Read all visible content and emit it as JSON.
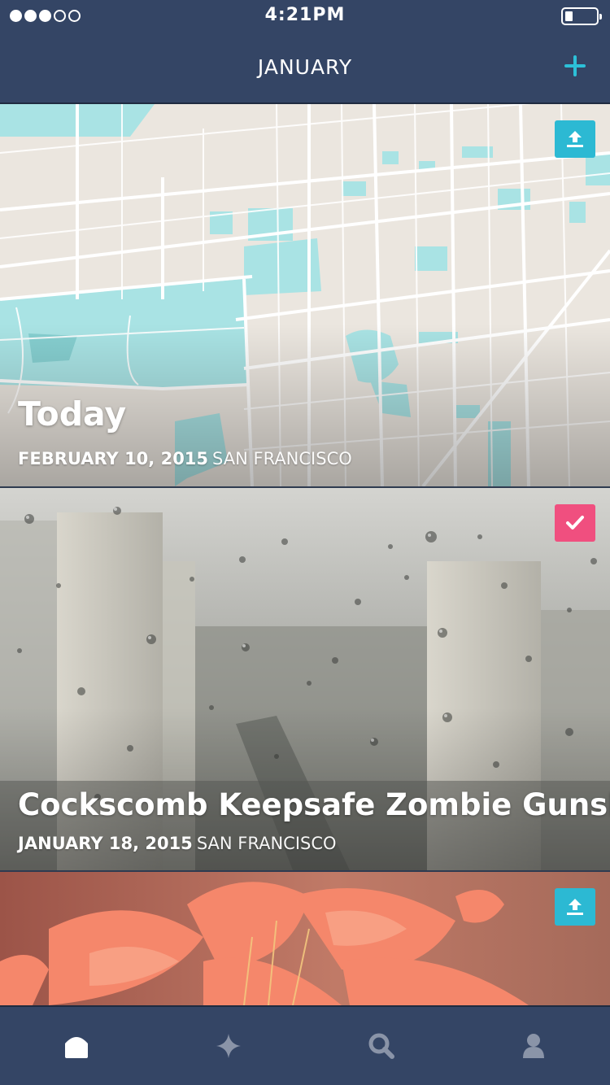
{
  "status_bar": {
    "signal_bars": [
      1,
      1,
      1,
      0,
      0
    ],
    "time": "4:21PM",
    "battery_level": 0.2
  },
  "header": {
    "title": "JANUARY",
    "add_icon": "plus-icon"
  },
  "cards": [
    {
      "title": "Today",
      "date": "FEBRUARY 10, 2015",
      "location": "SAN FRANCISCO",
      "background": "map",
      "badge_icon": "upload-icon",
      "badge_color": "#2cb9d3"
    },
    {
      "title": "Cockscomb Keepsafe Zombie Gunship",
      "date": "JANUARY 18, 2015",
      "location": "SAN FRANCISCO",
      "background": "rainy-window-city-photo",
      "badge_icon": "checkmark-icon",
      "badge_color": "#f04f7f"
    },
    {
      "title": "",
      "date": "",
      "location": "",
      "background": "orange-flower-photo",
      "badge_icon": "upload-icon",
      "badge_color": "#2cb9d3"
    }
  ],
  "tab_bar": {
    "tabs": [
      {
        "icon": "home-icon",
        "active": true
      },
      {
        "icon": "sparkle-icon",
        "active": false
      },
      {
        "icon": "search-icon",
        "active": false
      },
      {
        "icon": "profile-icon",
        "active": false
      }
    ]
  },
  "colors": {
    "nav_background": "#344565",
    "accent": "#2cc0d8",
    "checked": "#f04f7f",
    "map_water": "#a9e3e4",
    "map_land": "#ebe6df"
  }
}
